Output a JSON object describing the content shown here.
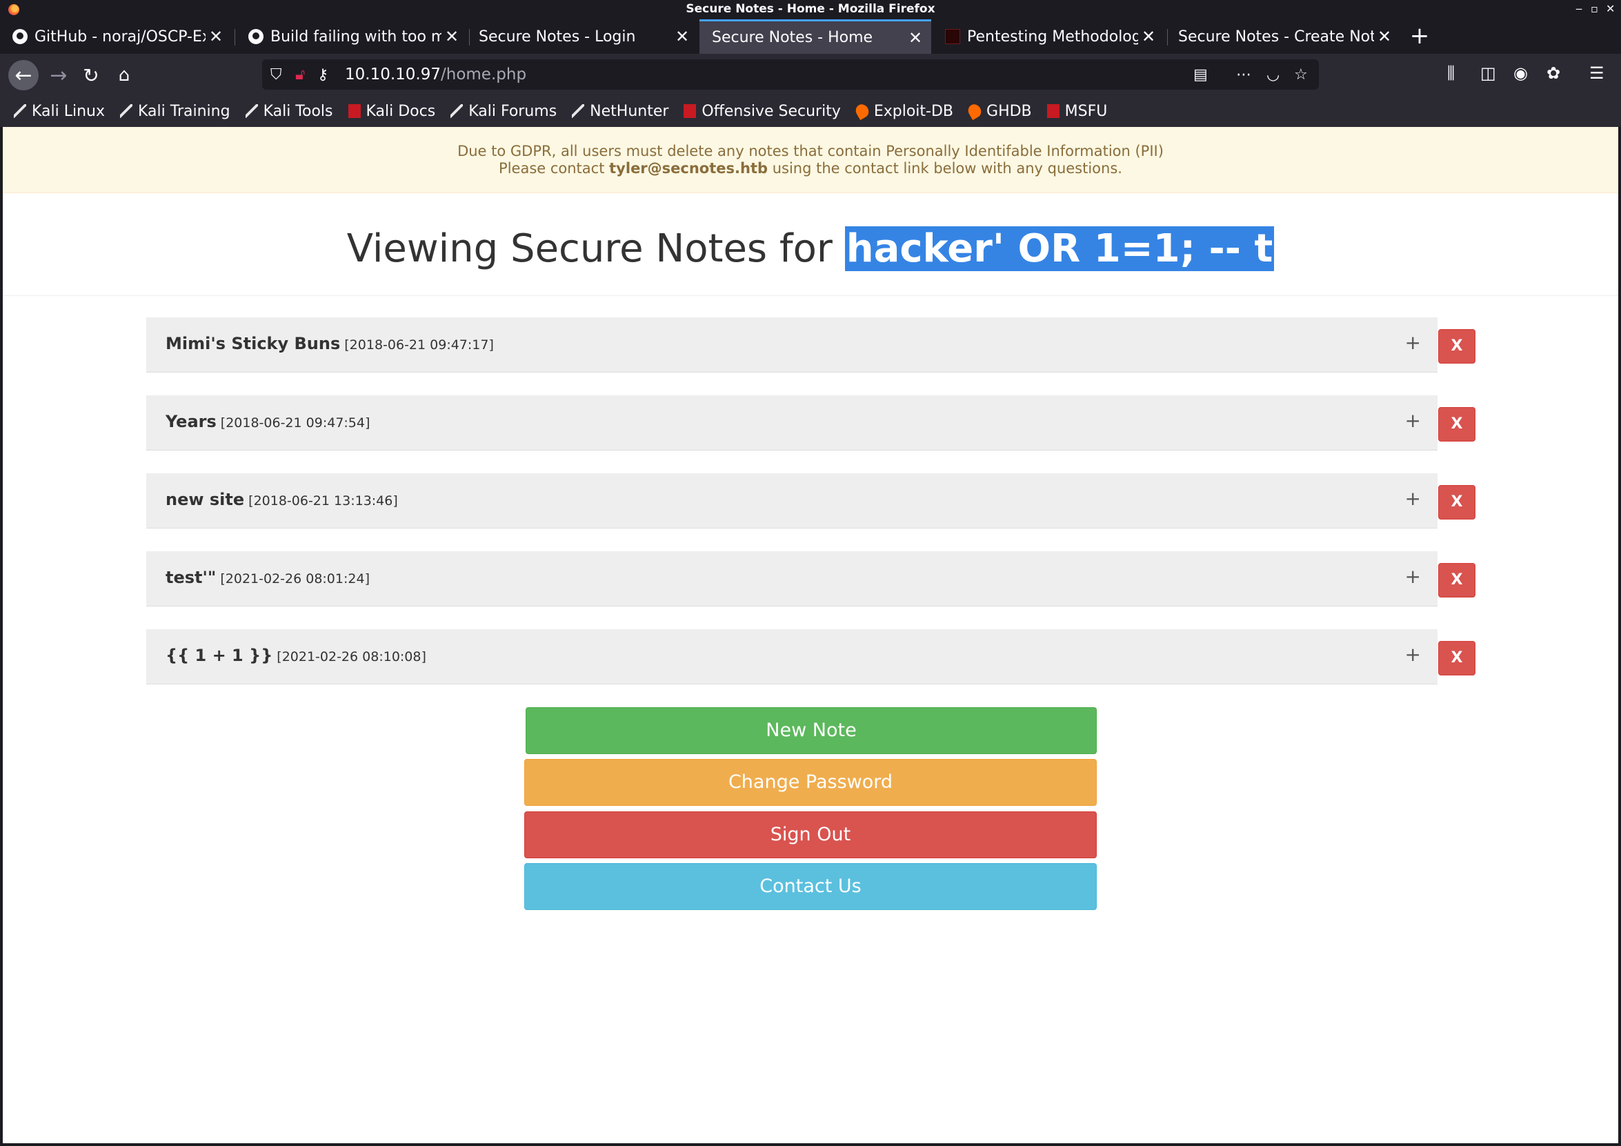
{
  "window": {
    "title": "Secure Notes - Home - Mozilla Firefox"
  },
  "tabs": [
    {
      "label": "GitHub - noraj/OSCP-Exam-Report-Template",
      "icon": "github-icon",
      "active": false
    },
    {
      "label": "Build failing with too many requests",
      "icon": "github-icon",
      "active": false
    },
    {
      "label": "Secure Notes - Login",
      "icon": "",
      "active": false
    },
    {
      "label": "Secure Notes - Home",
      "icon": "",
      "active": true
    },
    {
      "label": "Pentesting Methodology",
      "icon": "pentest-favicon-icon",
      "active": false
    },
    {
      "label": "Secure Notes - Create Note",
      "icon": "",
      "active": false
    }
  ],
  "url": {
    "host": "10.10.10.97",
    "path": "/home.php"
  },
  "bookmarks": [
    {
      "label": "Kali Linux",
      "icon": "kali-dragon-icon"
    },
    {
      "label": "Kali Training",
      "icon": "kali-dragon-icon"
    },
    {
      "label": "Kali Tools",
      "icon": "kali-dragon-icon"
    },
    {
      "label": "Kali Docs",
      "icon": "kali-docs-icon"
    },
    {
      "label": "Kali Forums",
      "icon": "kali-dragon-icon"
    },
    {
      "label": "NetHunter",
      "icon": "kali-dragon-icon"
    },
    {
      "label": "Offensive Security",
      "icon": "offsec-icon"
    },
    {
      "label": "Exploit-DB",
      "icon": "exploitdb-icon"
    },
    {
      "label": "GHDB",
      "icon": "exploitdb-icon"
    },
    {
      "label": "MSFU",
      "icon": "offsec-icon"
    }
  ],
  "banner": {
    "line1": "Due to GDPR, all users must delete any notes that contain Personally Identifable Information (PII)",
    "line2_prefix": "Please contact",
    "line2_email": "tyler@secnotes.htb",
    "line2_suffix": "using the contact link below with any questions."
  },
  "heading": {
    "prefix": "Viewing Secure Notes for",
    "username": "hacker' OR 1=1; -- t"
  },
  "notes": [
    {
      "title": "Mimi's Sticky Buns",
      "date": "[2018-06-21 09:47:17]",
      "expand": "+",
      "delete": "X"
    },
    {
      "title": "Years",
      "date": "[2018-06-21 09:47:54]",
      "expand": "+",
      "delete": "X"
    },
    {
      "title": "new site",
      "date": "[2018-06-21 13:13:46]",
      "expand": "+",
      "delete": "X"
    },
    {
      "title": "test'\"",
      "date": "[2021-02-26 08:01:24]",
      "expand": "+",
      "delete": "X"
    },
    {
      "title": "{{ 1 + 1 }}",
      "date": "[2021-02-26 08:10:08]",
      "expand": "+",
      "delete": "X"
    }
  ],
  "actions": {
    "new_note": "New Note",
    "change_password": "Change Password",
    "sign_out": "Sign Out",
    "contact_us": "Contact Us"
  },
  "colors": {
    "success": "#5cb85c",
    "warning": "#f0ad4e",
    "danger": "#d9534f",
    "info": "#5bc0de",
    "selection": "#3584e4",
    "tab_accent": "#45a1ff"
  }
}
